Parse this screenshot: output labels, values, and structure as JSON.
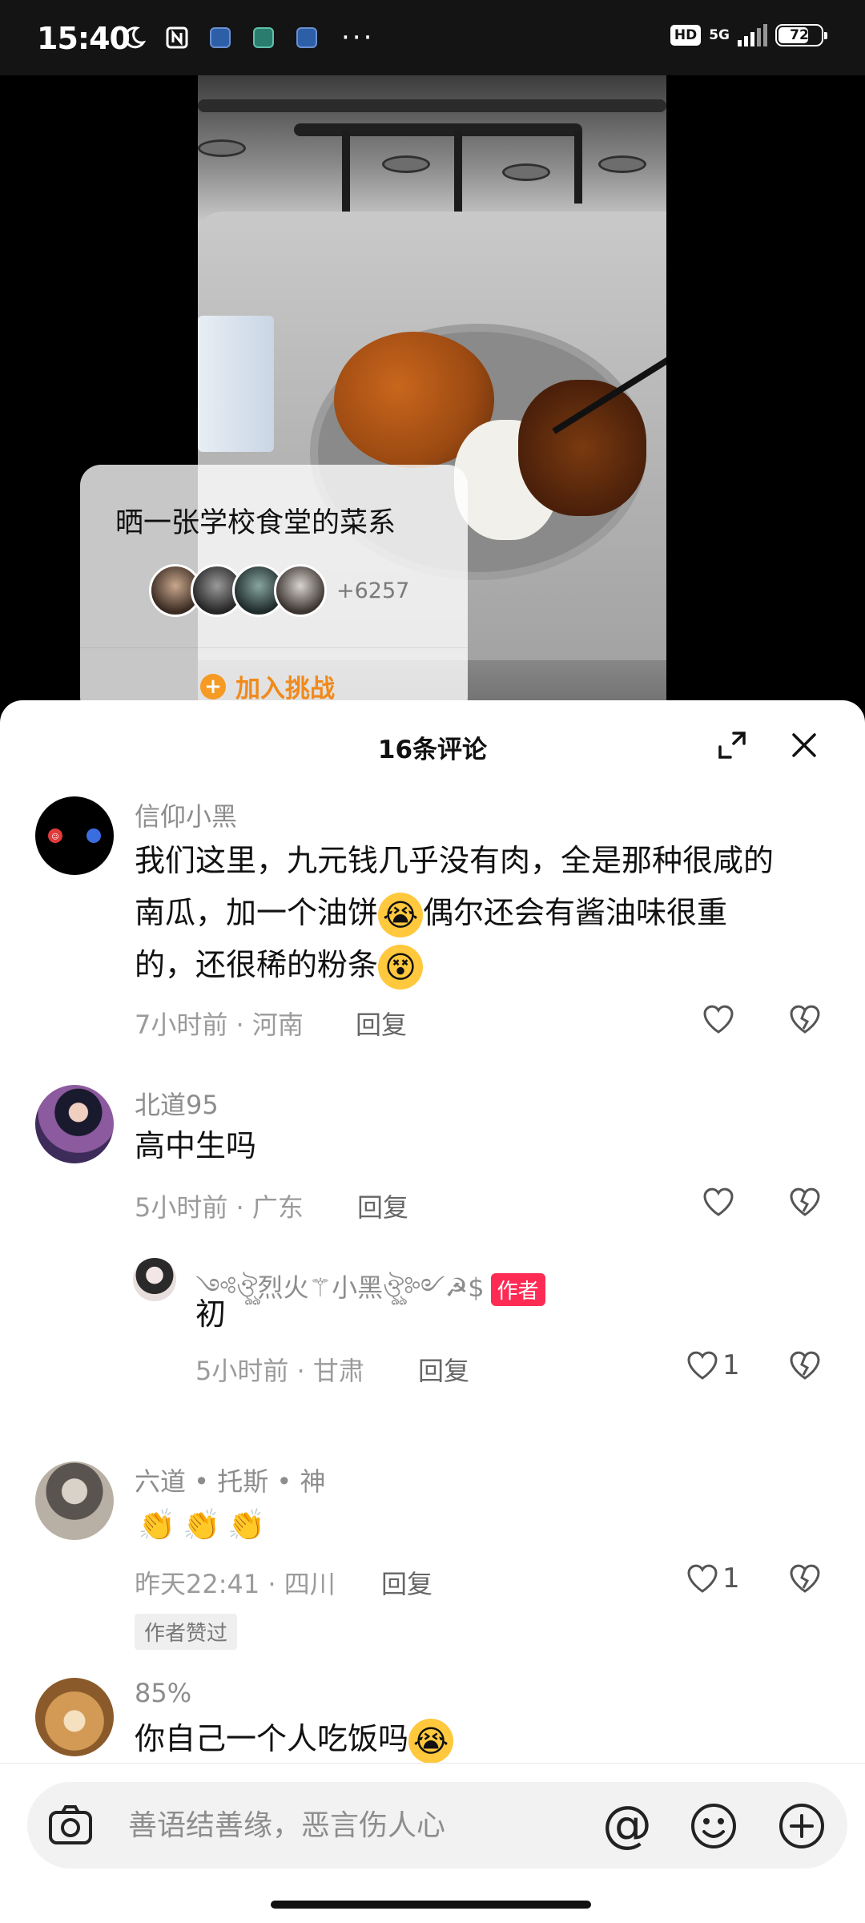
{
  "status_bar": {
    "time": "15:40",
    "hd": "HD",
    "network": "5G",
    "battery": "72",
    "battery_level": 0.72
  },
  "challenge": {
    "title": "晒一张学校食堂的菜系",
    "participants": "+6257",
    "join_label": "加入挑战"
  },
  "sheet": {
    "title": "16条评论"
  },
  "comments": [
    {
      "user": "信仰小黑",
      "lines": [
        "我们这里，九元钱几乎没有肉，全是那种很咸的",
        "南瓜，加一个油饼",
        "偶尔还会有酱油味很重",
        "的，还很稀的粉条"
      ],
      "time": "7小时前",
      "location": "河南",
      "reply": "回复"
    },
    {
      "user": "北道95",
      "text": "高中生吗",
      "time": "5小时前",
      "location": "广东",
      "reply": "回复"
    },
    {
      "user": "༺ঔৣ烈火⚚小黑ঔৣ༻☭$",
      "author_tag": "作者",
      "text": "初",
      "time": "5小时前",
      "location": "甘肃",
      "reply": "回复",
      "likes": "1"
    },
    {
      "user": "六道 • 托斯 • 神",
      "time": "昨天22:41",
      "location": "四川",
      "reply": "回复",
      "likes": "1",
      "liked_by_author": "作者赞过"
    },
    {
      "user": "85%",
      "text": "你自己一个人吃饭吗"
    }
  ],
  "meta_separator": "·",
  "input": {
    "placeholder": "善语结善缘，恶言伤人心",
    "at": "@"
  },
  "icons": {
    "camera": "camera-icon",
    "at": "at-icon",
    "emoji": "emoji-face-icon",
    "plus": "plus-circle-icon",
    "expand": "expand-icon",
    "close": "close-icon",
    "like": "heart-icon",
    "dislike": "broken-heart-icon"
  },
  "colors": {
    "accent": "#fe2c55",
    "challenge": "#f08a1c"
  }
}
